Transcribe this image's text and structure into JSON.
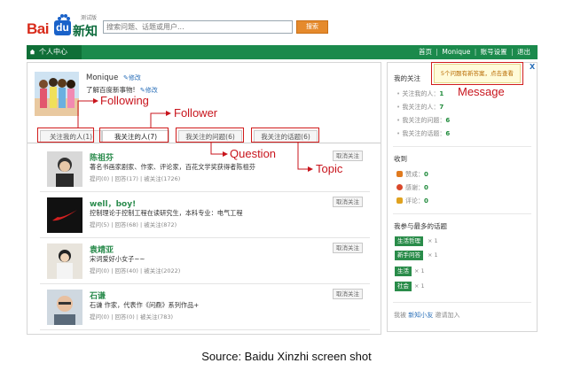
{
  "header": {
    "logo_bai": "Bai",
    "logo_du": "du",
    "logo_xinzhi": "新知",
    "logo_beta": "测试版",
    "search_placeholder": "搜索问题、话题或用户...",
    "search_button": "搜索"
  },
  "nav": {
    "home": "个人中心",
    "links": [
      "首页",
      "Monique",
      "账号设置",
      "退出"
    ],
    "separator": "|"
  },
  "profile": {
    "username": "Monique",
    "edit_label": "修改",
    "bio": "了解百度新事物!"
  },
  "tabs": [
    {
      "label": "关注我的人(1)",
      "active": false
    },
    {
      "label": "我关注的人(7)",
      "active": true
    },
    {
      "label": "我关注的问题(6)",
      "active": false
    },
    {
      "label": "我关注的话题(6)",
      "active": false
    }
  ],
  "users": [
    {
      "name": "陈祖芬",
      "desc": "著名书画家剧家、作家、评论家，百花文学奖获得者陈祖芬",
      "stats": "提问(0) | 回答(17) | 被关注(1726)",
      "action": "取消关注"
    },
    {
      "name": "well，boy!",
      "desc": "控制理论于控制工程在读研究生，本科专业：电气工程",
      "stats": "提问(5) | 回答(68) | 被关注(872)",
      "action": "取消关注"
    },
    {
      "name": "袁靖亚",
      "desc": "宋词爱好小女子~~",
      "stats": "提问(0) | 回答(40) | 被关注(2022)",
      "action": "取消关注"
    },
    {
      "name": "石谦",
      "desc": "石谦 作家，代表作《问鼎》系列作品+",
      "stats": "提问(0) | 回答(0) | 被关注(783)",
      "action": "取消关注"
    }
  ],
  "sidebar": {
    "my_follow_title": "我的关注",
    "message_notice": "5个问题有新答案，点击查看",
    "close": "X",
    "follow_stats": [
      {
        "label": "关注我的人：",
        "value": "1"
      },
      {
        "label": "我关注的人：",
        "value": "7"
      },
      {
        "label": "我关注的问题：",
        "value": "6"
      },
      {
        "label": "我关注的话题：",
        "value": "6"
      }
    ],
    "received_title": "收到",
    "received": [
      {
        "label": "赞成：",
        "value": "0",
        "color": "#e07a1f"
      },
      {
        "label": "感谢：",
        "value": "0",
        "color": "#d9482b"
      },
      {
        "label": "评论：",
        "value": "0",
        "color": "#e0a21f"
      }
    ],
    "topics_title": "我参与最多的话题",
    "topics": [
      {
        "name": "生活哲理",
        "count": "× 1"
      },
      {
        "name": "新手问答",
        "count": "× 1"
      },
      {
        "name": "生活",
        "count": "× 1"
      },
      {
        "name": "社会",
        "count": "× 1"
      }
    ],
    "invite_prefix": "我被",
    "invite_link": "新知小友",
    "invite_suffix": "邀请加入"
  },
  "annotations": {
    "following": "Following",
    "follower": "Follower",
    "question": "Question",
    "topic": "Topic",
    "message": "Message"
  },
  "caption": "Source: Baidu Xinzhi screen shot",
  "colors": {
    "brand_green": "#1b8a4c",
    "annotation_red": "#c8141c",
    "search_button": "#e58a2c"
  }
}
